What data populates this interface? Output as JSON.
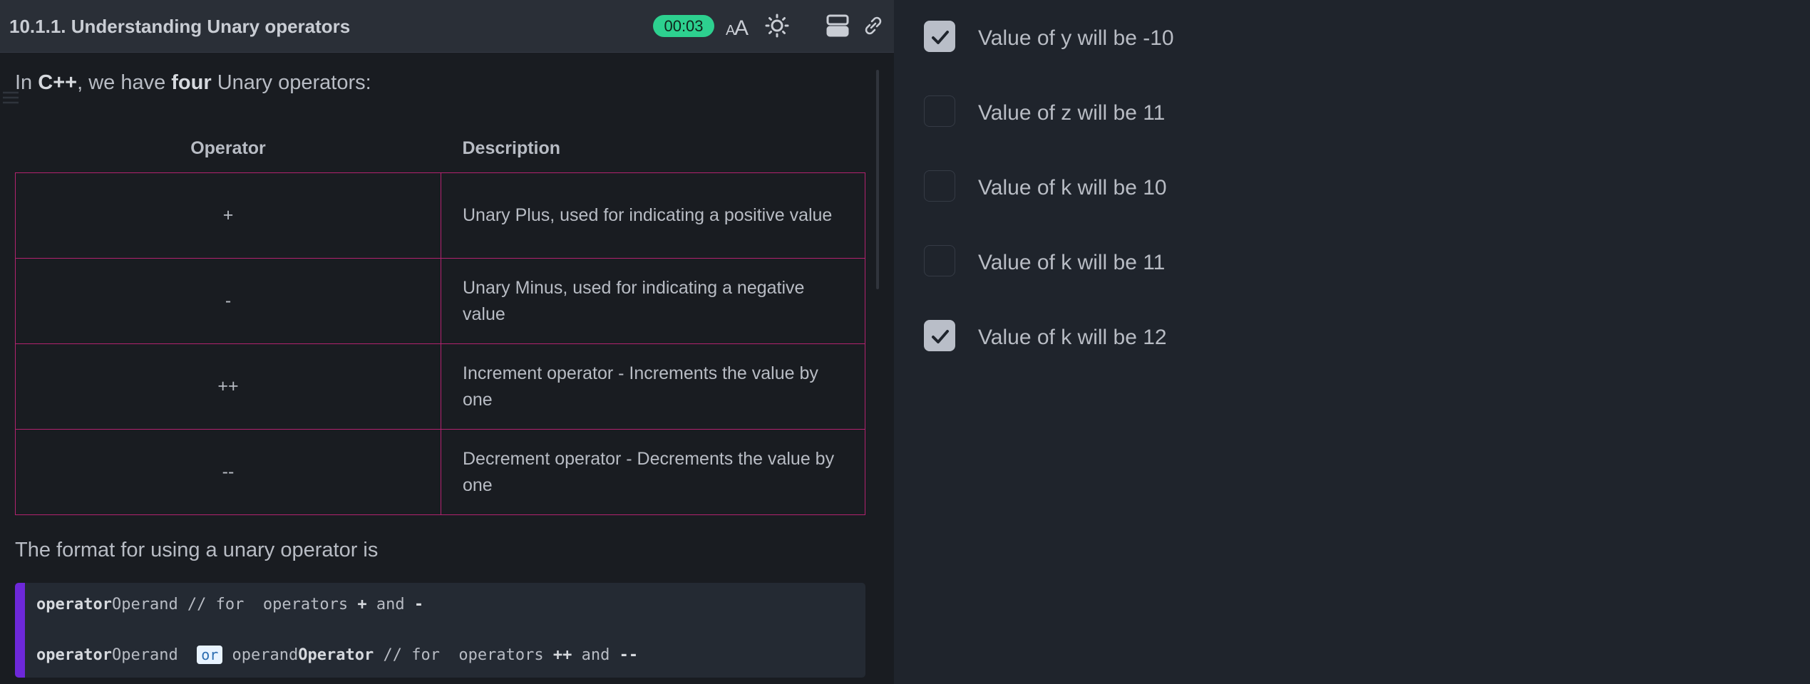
{
  "header": {
    "title": "10.1.1. Understanding Unary operators",
    "timer": "00:03",
    "icons": [
      "font-size-icon",
      "brightness-icon",
      "layout-icon",
      "link-icon"
    ]
  },
  "content": {
    "intro_prefix": "In ",
    "intro_lang": "C++",
    "intro_middle": ", we have ",
    "intro_count": "four",
    "intro_suffix": " Unary operators:",
    "table": {
      "headers": [
        "Operator",
        "Description"
      ],
      "rows": [
        {
          "operator": "+",
          "description": "Unary Plus, used for indicating a positive value"
        },
        {
          "operator": "-",
          "description": "Unary Minus, used for indicating a negative value"
        },
        {
          "operator": "++",
          "description": "Increment operator - Increments the value by one"
        },
        {
          "operator": "--",
          "description": "Decrement operator - Decrements the value by one"
        }
      ]
    },
    "format_text": "The format for using a unary operator is",
    "code": {
      "line1_kw": "operator",
      "line1_rest": "Operand // for  operators ",
      "line1_op1": "+",
      "line1_and": " and ",
      "line1_op2": "-",
      "line2_kw": "operator",
      "line2_mid": "Operand  ",
      "line2_or": "or",
      "line2_operand": " operand",
      "line2_kw2": "Operator",
      "line2_rest": " // for  operators ",
      "line2_op1": "++",
      "line2_and": " and ",
      "line2_op2": "--"
    }
  },
  "options": [
    {
      "label": "Value of y will be -10",
      "checked": true
    },
    {
      "label": "Value of z will be 11",
      "checked": false
    },
    {
      "label": "Value of k will be 10",
      "checked": false
    },
    {
      "label": "Value of k will be 11",
      "checked": false
    },
    {
      "label": "Value of k will be 12",
      "checked": true
    }
  ],
  "colors": {
    "timer_bg": "#2dd08f",
    "table_border": "#b2236f",
    "code_accent": "#6d28d9",
    "checkbox_checked": "#b9bec8"
  }
}
